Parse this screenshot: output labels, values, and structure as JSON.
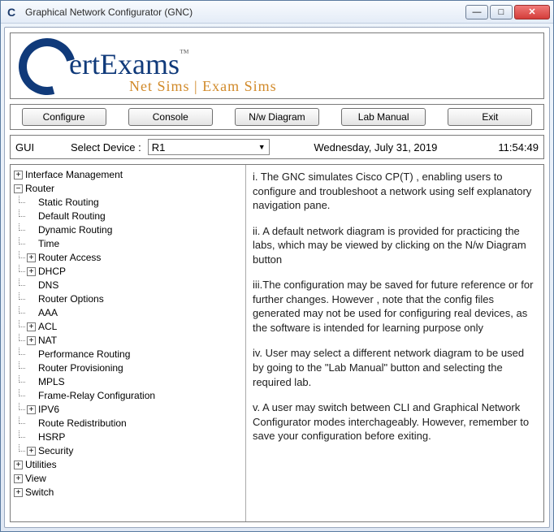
{
  "window": {
    "title": "Graphical Network Configurator (GNC)"
  },
  "logo": {
    "main": "ertExams",
    "tm": "™",
    "sub": "Net Sims | Exam Sims"
  },
  "buttons": {
    "configure": "Configure",
    "console": "Console",
    "nwdiagram": "N/w Diagram",
    "labmanual": "Lab Manual",
    "exit": "Exit"
  },
  "infobar": {
    "gui": "GUI",
    "select_label": "Select Device :",
    "selected_device": "R1",
    "date": "Wednesday, July 31, 2019",
    "time": "11:54:49"
  },
  "tree": {
    "n0": "Interface Management",
    "n1": "Router",
    "n1_0": "Static Routing",
    "n1_1": "Default Routing",
    "n1_2": "Dynamic Routing",
    "n1_3": "Time",
    "n1_4": "Router Access",
    "n1_5": "DHCP",
    "n1_6": "DNS",
    "n1_7": "Router Options",
    "n1_8": "AAA",
    "n1_9": "ACL",
    "n1_10": "NAT",
    "n1_11": "Performance Routing",
    "n1_12": "Router Provisioning",
    "n1_13": "MPLS",
    "n1_14": "Frame-Relay Configuration",
    "n1_15": "IPV6",
    "n1_16": "Route Redistribution",
    "n1_17": "HSRP",
    "n1_18": "Security",
    "n2": "Utilities",
    "n3": "View",
    "n4": "Switch"
  },
  "info": {
    "p1": "i. The GNC simulates Cisco CP(T) , enabling users to configure and troubleshoot a network using self explanatory navigation pane.",
    "p2": "ii. A default network diagram is provided for practicing the labs, which may be viewed by clicking on the N/w Diagram button",
    "p3": "iii.The configuration may be saved for future reference or for further changes. However , note that the config files generated may not be used for configuring real devices, as the software is intended for learning purpose only",
    "p4": "iv. User may select a different network diagram to be used by going to the \"Lab Manual\" button and selecting the required lab.",
    "p5": "v. A user may switch between CLI and Graphical Network Configurator modes interchageably. However, remember to save your configuration before exiting."
  }
}
